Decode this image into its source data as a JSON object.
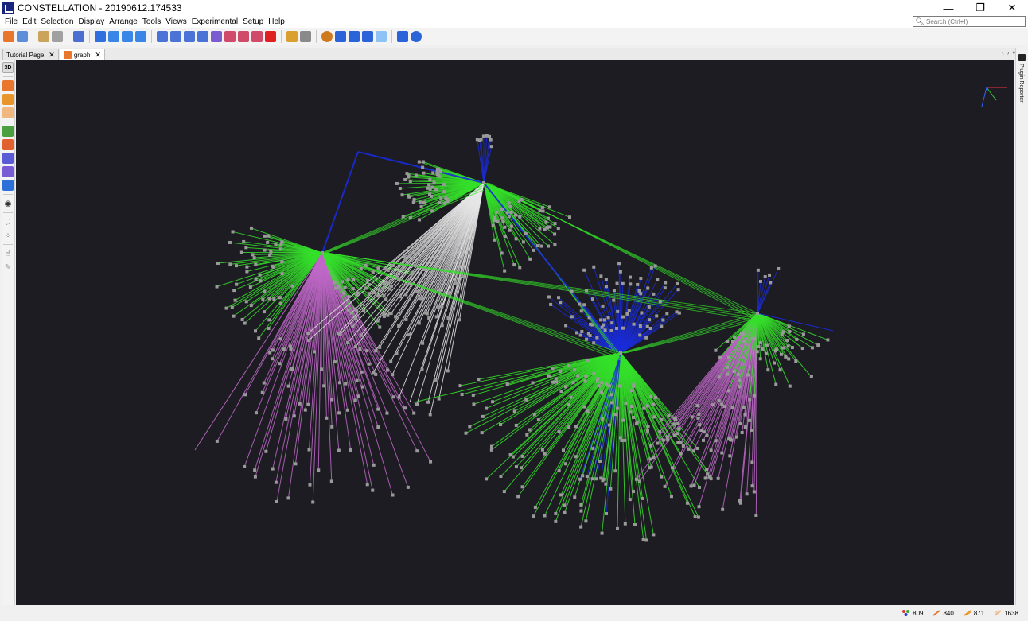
{
  "window": {
    "title": "CONSTELLATION - 20190612.174533",
    "controls": {
      "minimize": "—",
      "restore": "❐",
      "close": "✕"
    }
  },
  "menu": [
    "File",
    "Edit",
    "Selection",
    "Display",
    "Arrange",
    "Tools",
    "Views",
    "Experimental",
    "Setup",
    "Help"
  ],
  "search": {
    "placeholder": "Search (Ctrl+I)",
    "icon": "search-icon"
  },
  "tabs": [
    {
      "label": "Tutorial Page",
      "active": false
    },
    {
      "label": "graph",
      "active": true
    }
  ],
  "left_toolbar": {
    "mode_label": "3D"
  },
  "right_panel": {
    "label": "Plugin Reporter"
  },
  "status": {
    "nodes": "809",
    "transactions": "840",
    "edges": "871",
    "links": "1638"
  },
  "colors": {
    "canvas_bg": "#1c1c22",
    "edge_green": "#35e02a",
    "edge_pink": "#c169c9",
    "edge_white": "#e6e6e6",
    "edge_blue": "#1a2bd8",
    "node": "#9a9a9a"
  }
}
